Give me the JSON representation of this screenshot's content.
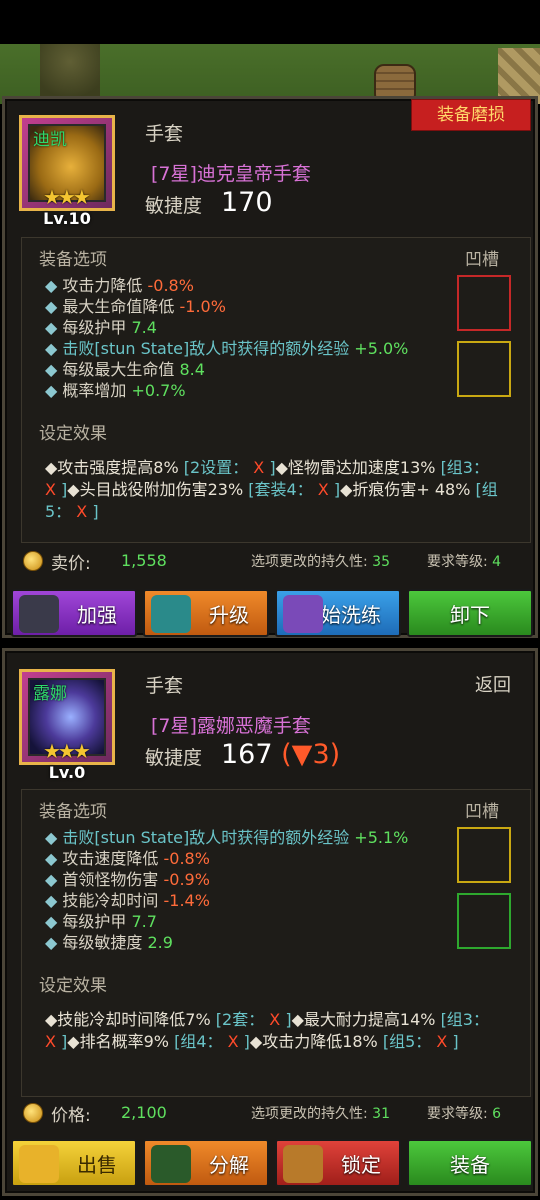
{
  "item1": {
    "icon_tag": "迪凯",
    "stars": "★★★",
    "level": "Lv.10",
    "category": "手套",
    "name": "[7星]迪克皇帝手套",
    "stat_label": "敏捷度",
    "stat_value": "170",
    "badge": "装备磨损",
    "options_header": "装备选项",
    "socket_header": "凹槽",
    "options": [
      {
        "text": "攻击力降低",
        "value": "-0.8%"
      },
      {
        "text": "最大生命值降低",
        "value": "-1.0%"
      },
      {
        "text": " 每级护甲",
        "value": "7.4"
      },
      {
        "text": "击败[stun State]敌人时获得的额外经验",
        "value": "+5.0%"
      },
      {
        "text": "每级最大生命值",
        "value": "8.4"
      },
      {
        "text": "概率增加",
        "value": "+0.7%"
      }
    ],
    "socket_colors": [
      "#c62828",
      "#c9a812"
    ],
    "effect_header": "设定效果",
    "effect_parts": [
      {
        "t": "◆攻击强度提高8% ",
        "c": "w"
      },
      {
        "t": "[2设置： ",
        "c": "k"
      },
      {
        "t": "X",
        "c": "x"
      },
      {
        "t": " ]",
        "c": "k"
      },
      {
        "t": "◆怪物雷达加速度13% ",
        "c": "w"
      },
      {
        "t": "[组3： ",
        "c": "k"
      },
      {
        "t": "X",
        "c": "x"
      },
      {
        "t": " ]",
        "c": "k"
      },
      {
        "t": "◆头目战役附加伤害23% ",
        "c": "w"
      },
      {
        "t": "[套装4： ",
        "c": "k"
      },
      {
        "t": "X",
        "c": "x"
      },
      {
        "t": " ]",
        "c": "k"
      },
      {
        "t": "◆折痕伤害+ 48% ",
        "c": "w"
      },
      {
        "t": "[组5： ",
        "c": "k"
      },
      {
        "t": "X",
        "c": "x"
      },
      {
        "t": " ]",
        "c": "k"
      }
    ],
    "price_label": "卖价:",
    "price": "1,558",
    "durability_label": "选项更改的持久性:",
    "durability": "35",
    "req_label": "要求等级:",
    "req_level": "4",
    "buttons": [
      "加强",
      "升级",
      "开始洗练",
      "卸下"
    ]
  },
  "item2": {
    "icon_tag": "露娜",
    "stars": "★★★",
    "level": "Lv.0",
    "category": "手套",
    "back": "返回",
    "name": "[7星]露娜恶魔手套",
    "stat_label": "敏捷度",
    "stat_value": "167",
    "stat_delta": "(▼3)",
    "options_header": "装备选项",
    "socket_header": "凹槽",
    "options": [
      {
        "text": "击败[stun State]敌人时获得的额外经验",
        "value": "+5.1%"
      },
      {
        "text": "攻击速度降低",
        "value": "-0.8%"
      },
      {
        "text": "首领怪物伤害",
        "value": "-0.9%"
      },
      {
        "text": "技能冷却时间",
        "value": "-1.4%"
      },
      {
        "text": " 每级护甲",
        "value": "7.7"
      },
      {
        "text": "每级敏捷度",
        "value": "2.9"
      }
    ],
    "socket_colors": [
      "#c9a812",
      "#2ea82e"
    ],
    "effect_header": "设定效果",
    "effect_parts": [
      {
        "t": "◆技能冷却时间降低7% ",
        "c": "w"
      },
      {
        "t": "[2套： ",
        "c": "k"
      },
      {
        "t": "X",
        "c": "x"
      },
      {
        "t": " ]",
        "c": "k"
      },
      {
        "t": "◆最大耐力提高14% ",
        "c": "w"
      },
      {
        "t": "[组3： ",
        "c": "k"
      },
      {
        "t": "X",
        "c": "x"
      },
      {
        "t": " ]",
        "c": "k"
      },
      {
        "t": "◆排名概率9% ",
        "c": "w"
      },
      {
        "t": "[组4： ",
        "c": "k"
      },
      {
        "t": "X",
        "c": "x"
      },
      {
        "t": " ]",
        "c": "k"
      },
      {
        "t": "◆攻击力降低18% ",
        "c": "w"
      },
      {
        "t": "[组5： ",
        "c": "k"
      },
      {
        "t": "X",
        "c": "x"
      },
      {
        "t": " ]",
        "c": "k"
      }
    ],
    "price_label": "价格:",
    "price": "2,100",
    "durability_label": "选项更改的持久性:",
    "durability": "31",
    "req_label": "要求等级:",
    "req_level": "6",
    "buttons": [
      "出售",
      "分解",
      "锁定",
      "装备"
    ]
  }
}
